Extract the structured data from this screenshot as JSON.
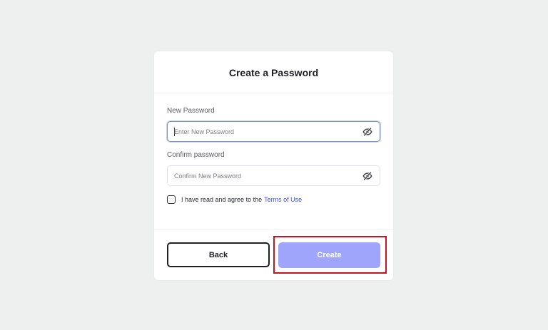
{
  "card": {
    "title": "Create a Password"
  },
  "new_password": {
    "label": "New Password",
    "placeholder": "Enter New Password",
    "value": ""
  },
  "confirm_password": {
    "label": "Confirm password",
    "placeholder": "Confirm New Password",
    "value": ""
  },
  "agreement": {
    "text": "I have read and agree to the",
    "link_text": "Terms of Use",
    "checked": false
  },
  "buttons": {
    "back_label": "Back",
    "create_label": "Create"
  },
  "icons": {
    "password_visibility": "eye-slash-icon"
  },
  "colors": {
    "accent": "#9ea5fb",
    "link": "#4453c5",
    "highlight": "#c8141d",
    "background": "#eef0f0"
  }
}
